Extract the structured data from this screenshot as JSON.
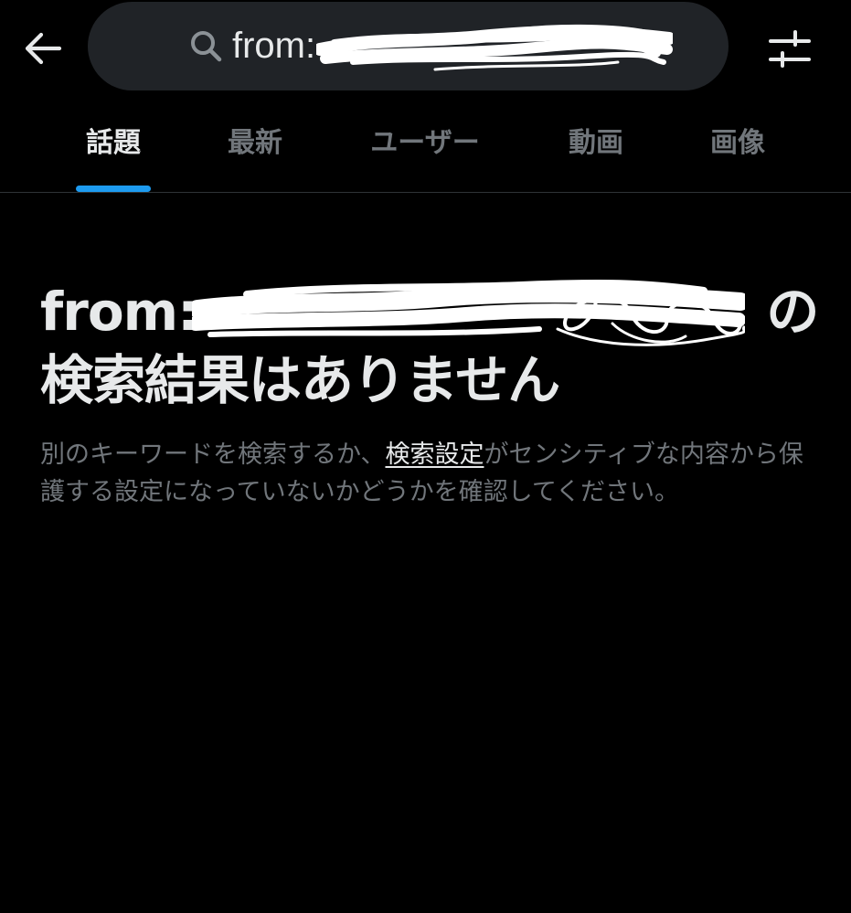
{
  "search": {
    "query": "from:"
  },
  "tabs": [
    {
      "label": "話題",
      "active": true
    },
    {
      "label": "最新",
      "active": false
    },
    {
      "label": "ユーザー",
      "active": false
    },
    {
      "label": "動画",
      "active": false
    },
    {
      "label": "画像",
      "active": false
    }
  ],
  "empty_state": {
    "headline_prefix": "from:",
    "headline_suffix": "の",
    "headline_line2": "検索結果はありません",
    "body_before_link": "別のキーワードを検索するか、",
    "settings_link": "検索設定",
    "body_after_link": "がセンシティブな内容から保護する設定になっていないかどうかを確認してください。"
  },
  "icons": {
    "back": "arrow-left-icon",
    "search": "search-icon",
    "filter": "sliders-icon"
  },
  "colors": {
    "background": "#000000",
    "pill": "#202327",
    "text_primary": "#e7e9ea",
    "text_secondary": "#71767b",
    "accent": "#1d9bf0",
    "divider": "#2f3336"
  }
}
